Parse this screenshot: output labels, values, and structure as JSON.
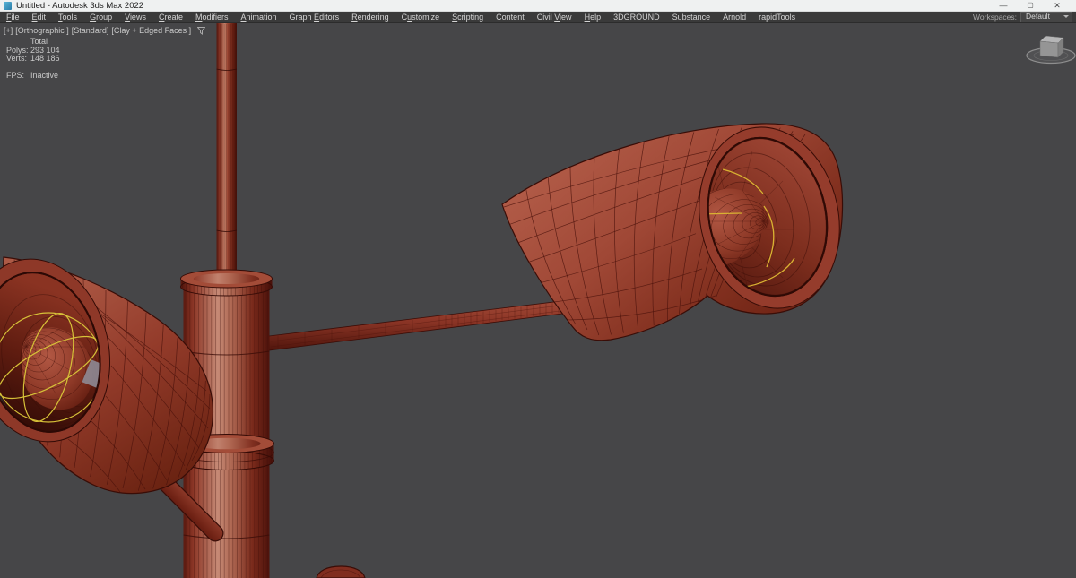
{
  "window": {
    "title": "Untitled - Autodesk 3ds Max 2022",
    "controls": {
      "minimize": "—",
      "maximize": "▢",
      "close": "✕"
    }
  },
  "menu": {
    "items": [
      {
        "label": "File",
        "u": 0
      },
      {
        "label": "Edit",
        "u": 0
      },
      {
        "label": "Tools",
        "u": 0
      },
      {
        "label": "Group",
        "u": 0
      },
      {
        "label": "Views",
        "u": 0
      },
      {
        "label": "Create",
        "u": 0
      },
      {
        "label": "Modifiers",
        "u": 0
      },
      {
        "label": "Animation",
        "u": 0
      },
      {
        "label": "Graph Editors",
        "u": 6
      },
      {
        "label": "Rendering",
        "u": 0
      },
      {
        "label": "Customize",
        "u": 1
      },
      {
        "label": "Scripting",
        "u": 0
      },
      {
        "label": "Content",
        "u": -1
      },
      {
        "label": "Civil View",
        "u": 6
      },
      {
        "label": "Help",
        "u": 0
      },
      {
        "label": "3DGROUND",
        "u": -1
      },
      {
        "label": "Substance",
        "u": -1
      },
      {
        "label": "Arnold",
        "u": -1
      },
      {
        "label": "rapidTools",
        "u": -1
      }
    ],
    "workspaces_label": "Workspaces:",
    "workspace_value": "Default"
  },
  "viewport": {
    "label": {
      "pos": "[+]",
      "view": "[Orthographic ]",
      "standard": "[Standard]",
      "shading": "[Clay + Edged Faces ]"
    },
    "stats": {
      "total_label": "Total",
      "polys_label": "Polys:",
      "polys_value": "293 104",
      "verts_label": "Verts:",
      "verts_value": "148 186",
      "fps_label": "FPS:",
      "fps_value": "Inactive"
    },
    "viewcube": "view-cube"
  },
  "colors": {
    "viewport_bg": "#464648",
    "menubar_bg": "#3a3a3a",
    "titlebar_bg": "#eff1f1",
    "clay_red": "#9d4332",
    "wire_dark": "#40100a",
    "gizmo_yellow": "#d9b232",
    "text_light": "#cfcfcf"
  }
}
